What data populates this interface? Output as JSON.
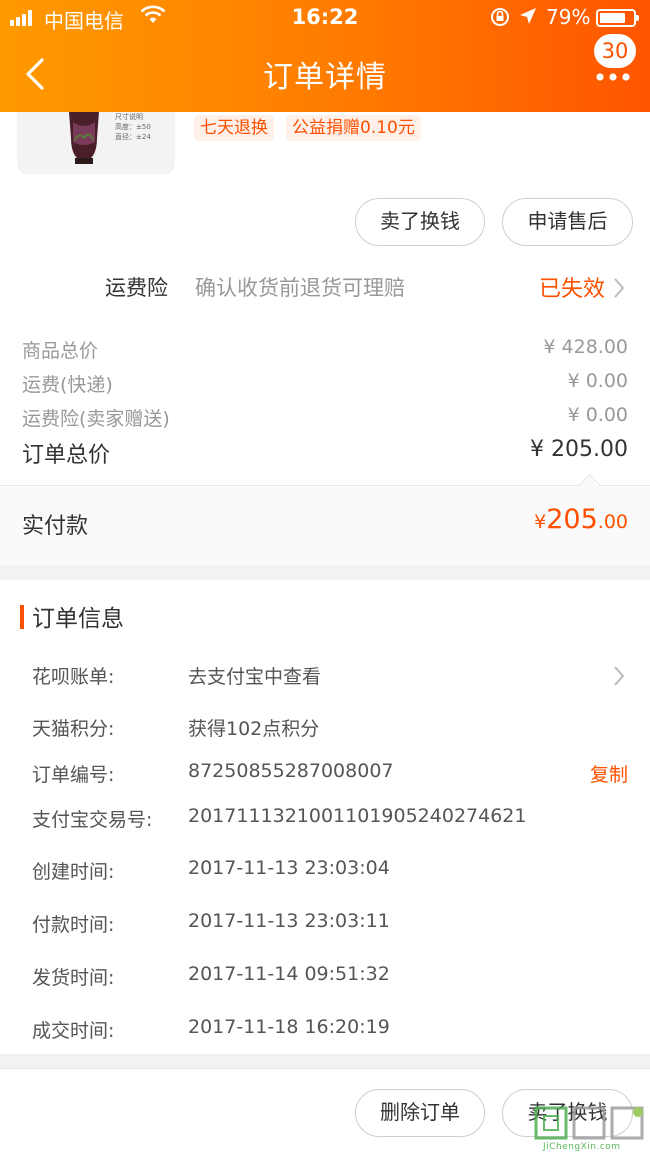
{
  "status_bar": {
    "carrier": "中国电信",
    "time": "16:22",
    "battery_percent": "79%",
    "battery_level": 0.79
  },
  "nav": {
    "title": "订单详情",
    "badge_count": "30",
    "back_icon": "chevron-left-icon",
    "more_icon": "more-dots-icon"
  },
  "product": {
    "thumb_lines": [
      "尺寸说明",
      "高度：±50",
      "直径：±24"
    ],
    "tags": [
      "七天退换",
      "公益捐赠0.10元"
    ]
  },
  "actions_top": {
    "sell_label": "卖了换钱",
    "after_sale_label": "申请售后"
  },
  "insurance": {
    "label": "运费险",
    "description": "确认收货前退货可理赔",
    "status": "已失效"
  },
  "prices": {
    "goods_label": "商品总价",
    "goods_value": "¥ 428.00",
    "shipping_label": "运费(快递)",
    "shipping_value": "¥ 0.00",
    "insurance_label": "运费险(卖家赠送)",
    "insurance_value": "¥ 0.00",
    "total_label": "订单总价",
    "total_value": "¥ 205.00",
    "paid_label": "实付款",
    "paid_currency": "¥",
    "paid_integer": "205",
    "paid_decimal": ".00"
  },
  "order_info": {
    "title": "订单信息",
    "rows": [
      {
        "key": "花呗账单:",
        "value": "去支付宝中查看"
      },
      {
        "key": "天猫积分:",
        "value": "获得102点积分"
      },
      {
        "key": "订单编号:",
        "value": "87250855287008007",
        "action": "复制"
      },
      {
        "key": "支付宝交易号:",
        "value": "2017111321001101905240274621"
      },
      {
        "key": "创建时间:",
        "value": "2017-11-13 23:03:04"
      },
      {
        "key": "付款时间:",
        "value": "2017-11-13 23:03:11"
      },
      {
        "key": "发货时间:",
        "value": "2017-11-14 09:51:32"
      },
      {
        "key": "成交时间:",
        "value": "2017-11-18 16:20:19"
      }
    ]
  },
  "bottom_actions": {
    "delete_label": "删除订单",
    "sell_label": "卖了换钱"
  },
  "watermark": {
    "text": "JiChengXin.com"
  },
  "colors": {
    "accent": "#ff5000",
    "header_start": "#ff9a00",
    "header_end": "#ff5500"
  }
}
